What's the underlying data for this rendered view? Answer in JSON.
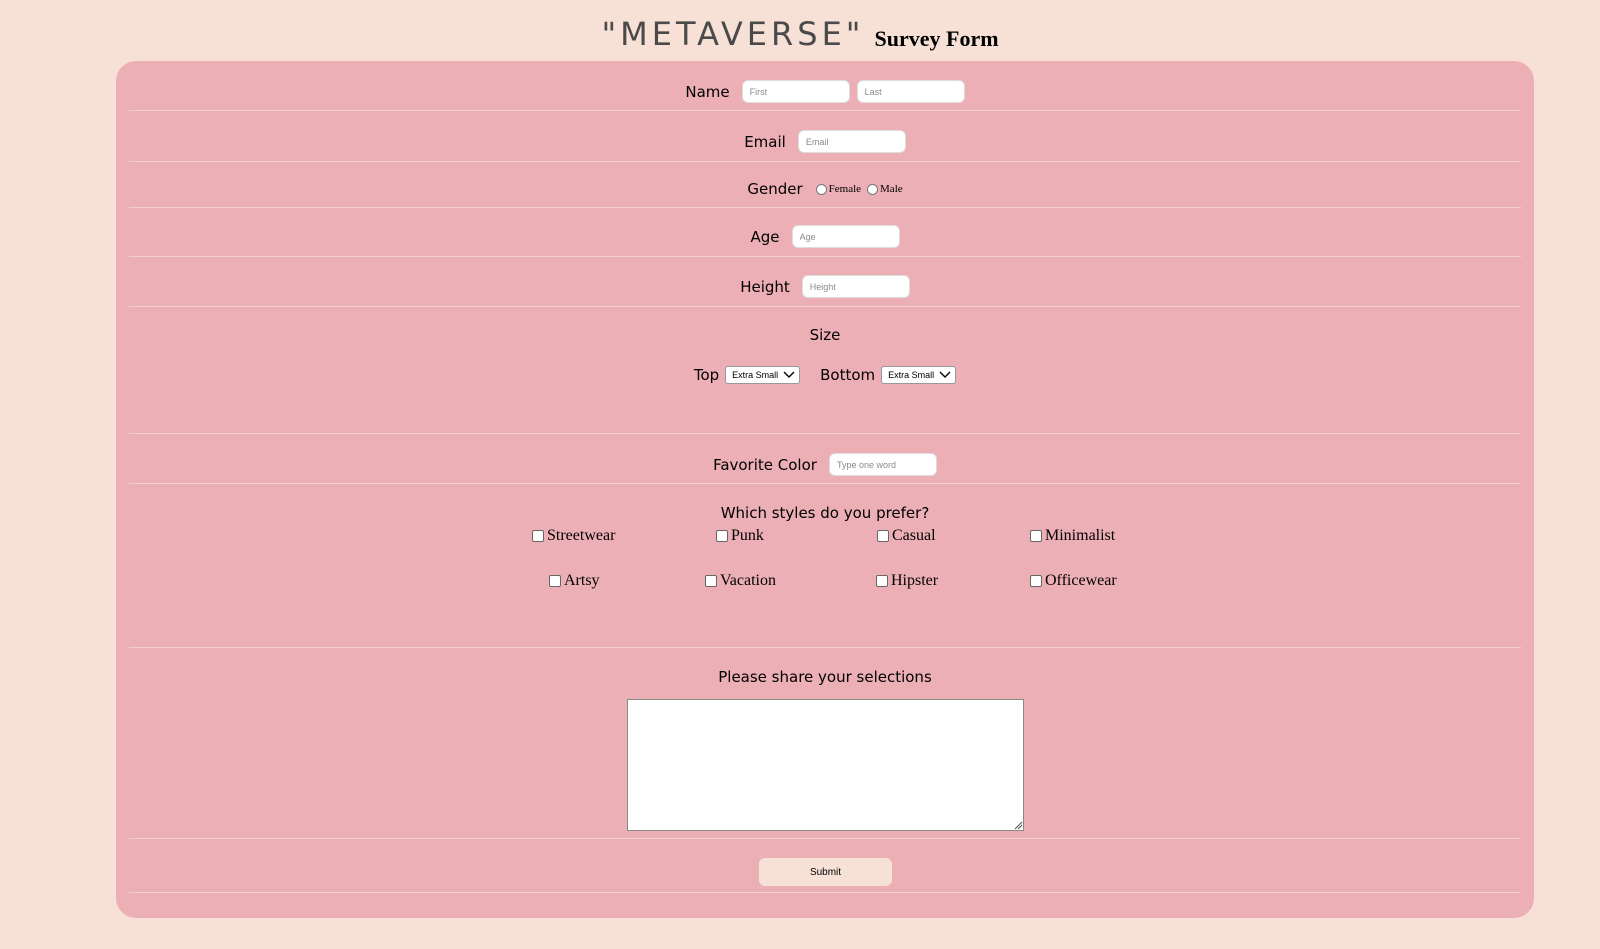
{
  "header": {
    "brand": "\"METAVERSE\"",
    "title": "Survey Form"
  },
  "form": {
    "name": {
      "label": "Name",
      "first_placeholder": "First",
      "last_placeholder": "Last"
    },
    "email": {
      "label": "Email",
      "placeholder": "Email"
    },
    "gender": {
      "label": "Gender",
      "options": [
        "Female",
        "Male"
      ]
    },
    "age": {
      "label": "Age",
      "placeholder": "Age"
    },
    "height": {
      "label": "Height",
      "placeholder": "Height"
    },
    "size": {
      "heading": "Size",
      "top_label": "Top",
      "top_value": "Extra Small",
      "bottom_label": "Bottom",
      "bottom_value": "Extra Small"
    },
    "favorite_color": {
      "label": "Favorite Color",
      "placeholder": "Type one word"
    },
    "styles": {
      "question": "Which styles do you prefer?",
      "options": [
        "Streetwear",
        "Punk",
        "Casual",
        "Minimalist",
        "Artsy",
        "Vacation",
        "Hipster",
        "Officewear"
      ]
    },
    "selections": {
      "label": "Please share your selections",
      "value": ""
    },
    "submit_label": "Submit"
  },
  "colors": {
    "page_background": "#f7e0d6",
    "card_background": "#ecafb5",
    "submit_background": "#f7e0d6"
  }
}
